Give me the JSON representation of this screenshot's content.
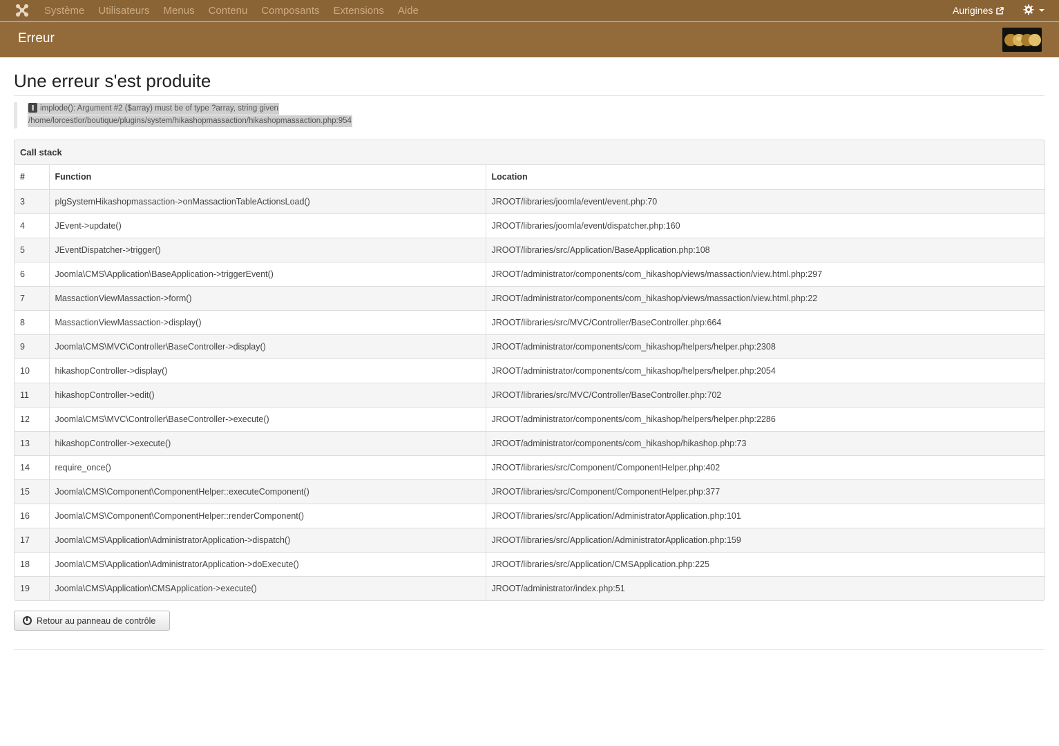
{
  "navbar": {
    "menu": [
      "Système",
      "Utilisateurs",
      "Menus",
      "Contenu",
      "Composants",
      "Extensions",
      "Aide"
    ],
    "site_name": "Aurigines"
  },
  "titlebar": {
    "title": "Erreur"
  },
  "heading": "Une erreur s'est produite",
  "error": {
    "message": "implode(): Argument #2 ($array) must be of type ?array, string given",
    "path": "/home/lorcestlor/boutique/plugins/system/hikashopmassaction/hikashopmassaction.php:954"
  },
  "callstack": {
    "title": "Call stack",
    "headers": {
      "num": "#",
      "function": "Function",
      "location": "Location"
    },
    "rows": [
      {
        "num": "3",
        "function": "plgSystemHikashopmassaction->onMassactionTableActionsLoad()",
        "location": "JROOT/libraries/joomla/event/event.php:70"
      },
      {
        "num": "4",
        "function": "JEvent->update()",
        "location": "JROOT/libraries/joomla/event/dispatcher.php:160"
      },
      {
        "num": "5",
        "function": "JEventDispatcher->trigger()",
        "location": "JROOT/libraries/src/Application/BaseApplication.php:108"
      },
      {
        "num": "6",
        "function": "Joomla\\CMS\\Application\\BaseApplication->triggerEvent()",
        "location": "JROOT/administrator/components/com_hikashop/views/massaction/view.html.php:297"
      },
      {
        "num": "7",
        "function": "MassactionViewMassaction->form()",
        "location": "JROOT/administrator/components/com_hikashop/views/massaction/view.html.php:22"
      },
      {
        "num": "8",
        "function": "MassactionViewMassaction->display()",
        "location": "JROOT/libraries/src/MVC/Controller/BaseController.php:664"
      },
      {
        "num": "9",
        "function": "Joomla\\CMS\\MVC\\Controller\\BaseController->display()",
        "location": "JROOT/administrator/components/com_hikashop/helpers/helper.php:2308"
      },
      {
        "num": "10",
        "function": "hikashopController->display()",
        "location": "JROOT/administrator/components/com_hikashop/helpers/helper.php:2054"
      },
      {
        "num": "11",
        "function": "hikashopController->edit()",
        "location": "JROOT/libraries/src/MVC/Controller/BaseController.php:702"
      },
      {
        "num": "12",
        "function": "Joomla\\CMS\\MVC\\Controller\\BaseController->execute()",
        "location": "JROOT/administrator/components/com_hikashop/helpers/helper.php:2286"
      },
      {
        "num": "13",
        "function": "hikashopController->execute()",
        "location": "JROOT/administrator/components/com_hikashop/hikashop.php:73"
      },
      {
        "num": "14",
        "function": "require_once()",
        "location": "JROOT/libraries/src/Component/ComponentHelper.php:402"
      },
      {
        "num": "15",
        "function": "Joomla\\CMS\\Component\\ComponentHelper::executeComponent()",
        "location": "JROOT/libraries/src/Component/ComponentHelper.php:377"
      },
      {
        "num": "16",
        "function": "Joomla\\CMS\\Component\\ComponentHelper::renderComponent()",
        "location": "JROOT/libraries/src/Application/AdministratorApplication.php:101"
      },
      {
        "num": "17",
        "function": "Joomla\\CMS\\Application\\AdministratorApplication->dispatch()",
        "location": "JROOT/libraries/src/Application/AdministratorApplication.php:159"
      },
      {
        "num": "18",
        "function": "Joomla\\CMS\\Application\\AdministratorApplication->doExecute()",
        "location": "JROOT/libraries/src/Application/CMSApplication.php:225"
      },
      {
        "num": "19",
        "function": "Joomla\\CMS\\Application\\CMSApplication->execute()",
        "location": "JROOT/administrator/index.php:51"
      }
    ]
  },
  "back_button": {
    "label": "Retour au panneau de contrôle"
  },
  "icons": {
    "logo": "joomla-logo-icon",
    "external": "external-link-icon",
    "settings": "gear-icon",
    "warning": "warning-icon",
    "dashboard": "dashboard-icon"
  }
}
